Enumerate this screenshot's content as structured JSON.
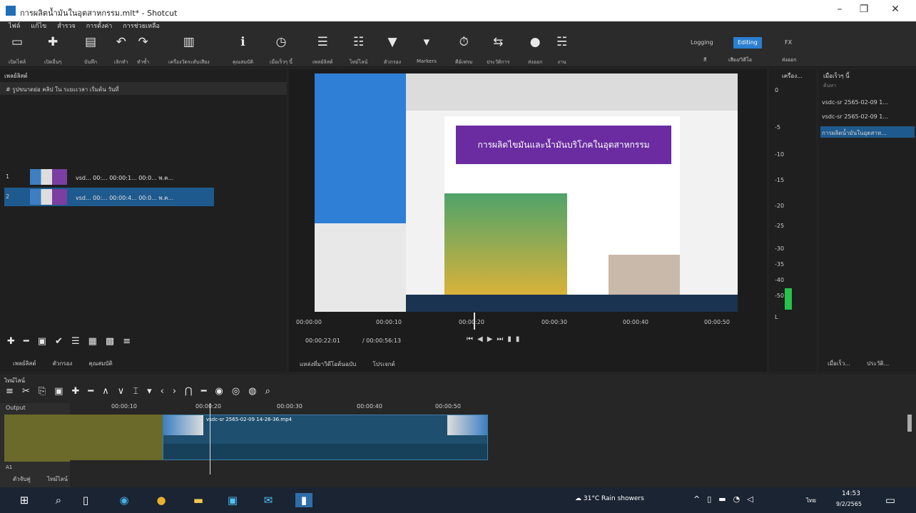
{
  "window": {
    "title": "การผลิตน้ำมันในอุตสาหกรรม.mlt* - Shotcut"
  },
  "menu": [
    "ไฟล์",
    "แก้ไข",
    "สำรวจ",
    "การตั้งค่า",
    "การช่วยเหลือ"
  ],
  "toolbar": {
    "open_label": "เปิดไฟล์",
    "open_other_label": "เปิดอื่นๆ",
    "save_label": "บันทึก",
    "undo_label": "เลิกทำ",
    "redo_label": "ทำซ้ำ",
    "peak_meter_label": "เครื่องวัดระดับเสียง",
    "properties_label": "คุณสมบัติ",
    "recent_label": "เมื่อเร็วๆ นี้",
    "playlist_label": "เพลย์ลิสต์",
    "timeline_label": "ไทม์ไลน์",
    "filters_label": "ตัวกรอง",
    "markers_label": "Markers",
    "keyframes_label": "คีย์เฟรม",
    "history_label": "ประวัติการ",
    "export_label": "ส่งออก",
    "jobs_label": "งาน",
    "logging_label": "Logging",
    "editing_label": "Editing",
    "fx_label": "FX",
    "layout_label1": "สี",
    "layout_label2": "เสียง/วิดีโอ",
    "layout_label3": "ส่งออก"
  },
  "playlist": {
    "title": "เพลย์ลิสต์",
    "headers": "# รูปขนาดย่อ คลิป ใน ระยะเวลา เริ่มต้น วันที่",
    "rows": [
      {
        "num": "1",
        "text": "vsd... 00:... 00:00:1... 00:0... พ.ค..."
      },
      {
        "num": "2",
        "text": "vsd... 00:... 00:00:4... 00:0... พ.ค..."
      }
    ],
    "tabs": [
      "เพลย์ลิสต์",
      "ตัวกรอง",
      "คุณสมบัติ"
    ]
  },
  "player": {
    "slide_title": "การผลิตไขมันและน้ำมันบริโภคในอุตสาหกรรม",
    "ruler": [
      "00:00:00",
      "00:00:10",
      "00:00:20",
      "00:00:30",
      "00:00:40",
      "00:00:50"
    ],
    "current_time": "00:00:22:01",
    "total_time": "/ 00:00:56:13",
    "tabs": [
      "แหล่งที่มาวิดีโอต้นฉบับ",
      "โปรเจกต์"
    ]
  },
  "meter": {
    "title": "เครื่อง...",
    "ticks": [
      "0",
      "-5",
      "-10",
      "-15",
      "-20",
      "-25",
      "-30",
      "-35",
      "-40",
      "-50",
      "L"
    ]
  },
  "recent": {
    "title": "เมื่อเร็วๆ นี้",
    "search_placeholder": "ค้นหา",
    "items": [
      "vsdc-sr 2565-02-09 1...",
      "vsdc-sr 2565-02-09 1...",
      "การผลิตน้ำมันในอุตสาห..."
    ],
    "tabs": [
      "เมื่อเร็ว...",
      "ประวัติ..."
    ]
  },
  "timeline": {
    "title": "ไทม์ไลน์",
    "output_label": "Output",
    "ruler": [
      "00:00:10",
      "00:00:20",
      "00:00:30",
      "00:00:40",
      "00:00:50"
    ],
    "track_v1": "V1",
    "track_a1": "A1",
    "clip_label": "vsdc-sr 2565-02-09 14-26-36.mp4",
    "tabs": [
      "ตัวจับคู่",
      "ไทม์ไลน์"
    ]
  },
  "taskbar": {
    "weather": "31°C  Rain showers",
    "lang": "ไทย",
    "time": "14:53",
    "date": "9/2/2565"
  },
  "colors": {
    "accent": "#2a7fd0",
    "selection": "#1e5a8e",
    "clip": "#1e4f6e",
    "output": "#6b6a2a",
    "taskbar": "#1b2433"
  }
}
